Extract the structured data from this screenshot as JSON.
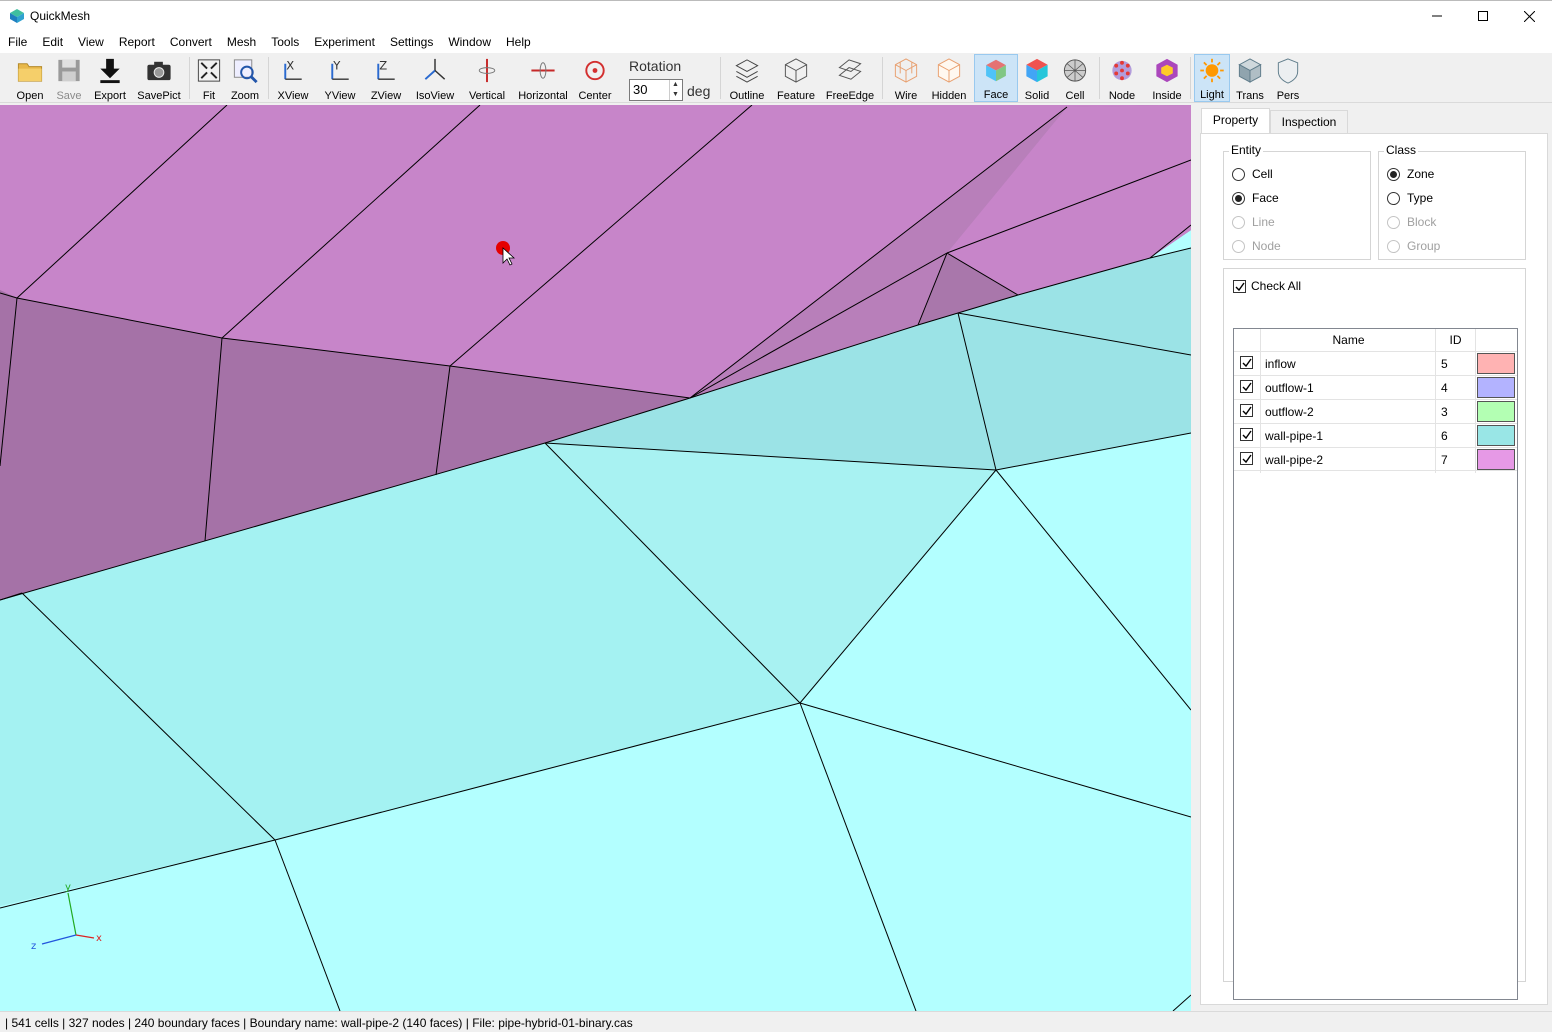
{
  "window": {
    "title": "QuickMesh"
  },
  "menu": [
    "File",
    "Edit",
    "View",
    "Report",
    "Convert",
    "Mesh",
    "Tools",
    "Experiment",
    "Settings",
    "Window",
    "Help"
  ],
  "toolbar": {
    "open": "Open",
    "save": "Save",
    "export": "Export",
    "savepict": "SavePict",
    "fit": "Fit",
    "zoom": "Zoom",
    "xview": "XView",
    "yview": "YView",
    "zview": "ZView",
    "isoview": "IsoView",
    "vertical": "Vertical",
    "horizontal": "Horizontal",
    "center": "Center",
    "rotation_label": "Rotation",
    "rotation_value": "30",
    "rotation_unit": "deg",
    "outline": "Outline",
    "feature": "Feature",
    "freeedge": "FreeEdge",
    "wire": "Wire",
    "hidden": "Hidden",
    "face": "Face",
    "solid": "Solid",
    "cell": "Cell",
    "node": "Node",
    "inside": "Inside",
    "light": "Light",
    "trans": "Trans",
    "pers": "Pers"
  },
  "panel": {
    "tabs": {
      "property": "Property",
      "inspection": "Inspection"
    },
    "entity": {
      "title": "Entity",
      "options": [
        {
          "label": "Cell",
          "checked": false,
          "enabled": true
        },
        {
          "label": "Face",
          "checked": true,
          "enabled": true
        },
        {
          "label": "Line",
          "checked": false,
          "enabled": false
        },
        {
          "label": "Node",
          "checked": false,
          "enabled": false
        }
      ]
    },
    "class": {
      "title": "Class",
      "options": [
        {
          "label": "Zone",
          "checked": true,
          "enabled": true
        },
        {
          "label": "Type",
          "checked": false,
          "enabled": true
        },
        {
          "label": "Block",
          "checked": false,
          "enabled": false
        },
        {
          "label": "Group",
          "checked": false,
          "enabled": false
        }
      ]
    },
    "check_all": "Check All",
    "grid": {
      "headers": {
        "name": "Name",
        "id": "ID"
      },
      "rows": [
        {
          "name": "inflow",
          "id": "5",
          "color": "#ffb3b3",
          "checked": true
        },
        {
          "name": "outflow-1",
          "id": "4",
          "color": "#b3b3ff",
          "checked": true
        },
        {
          "name": "outflow-2",
          "id": "3",
          "color": "#b3ffb3",
          "checked": true
        },
        {
          "name": "wall-pipe-1",
          "id": "6",
          "color": "#99e6e6",
          "checked": true
        },
        {
          "name": "wall-pipe-2",
          "id": "7",
          "color": "#e699e6",
          "checked": true
        }
      ]
    }
  },
  "axes": {
    "y": "y",
    "z": "z",
    "x": "x"
  },
  "colors": {
    "accent": "#cce4f7",
    "pipe2": "#c785c9",
    "pipe2_dark": "#a572a7",
    "pipe1": "#a4f2f2",
    "pipe1_light": "#b3ffff",
    "pipe1_dark": "#9be3e6"
  },
  "status": "| 541 cells | 327 nodes | 240 boundary faces |  Boundary name: wall-pipe-2 (140 faces) | File: pipe-hybrid-01-binary.cas"
}
